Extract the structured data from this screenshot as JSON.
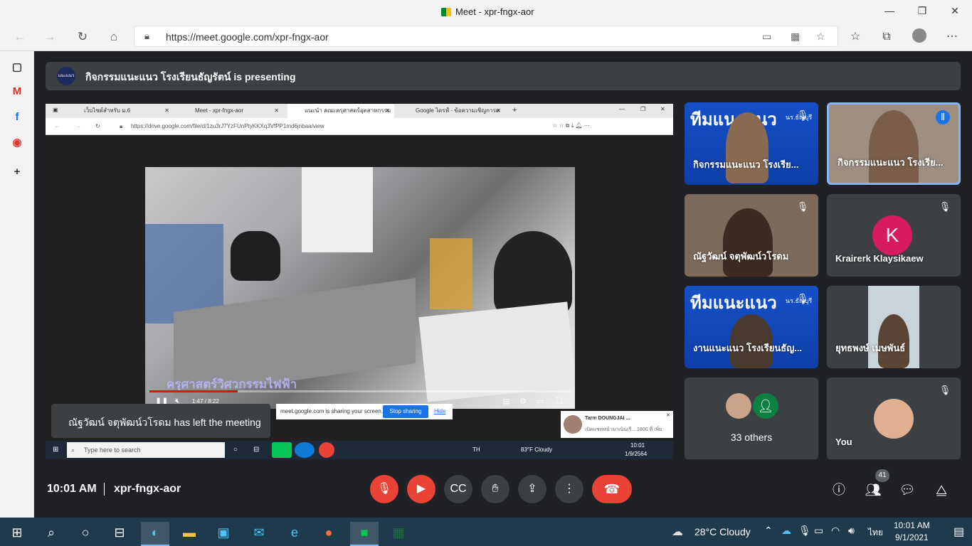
{
  "window": {
    "title": "Meet - xpr-fngx-aor"
  },
  "browser": {
    "url": "https://meet.google.com/xpr-fngx-aor"
  },
  "presenting": {
    "logo_text": "แนะแนว",
    "banner": "กิจกรรมแนะแนว โรงเรียนธัญรัตน์ is presenting"
  },
  "shared_screen": {
    "tabs": [
      {
        "label": "เว็บไซต์สำหรับ ม.6"
      },
      {
        "label": "Meet - xpr-fngx-aor"
      },
      {
        "label": "แนะนำ คณะครุศาสตร์อุตสาหกรรม มจ"
      },
      {
        "label": "Google ไดรฟ์ - ข้อความเชิญการต"
      }
    ],
    "url": "https://drive.google.com/file/d/1zu3rJ7YzFUnPtyKKXq3VfPP1md6jnbaa/view",
    "video_caption": "ครุศาสตร์วิศวกรรมไฟฟ้า",
    "video_time": "1:47 / 8:22",
    "video_progress": 0.21,
    "share_notice": "meet.google.com is sharing your screen.",
    "stop_sharing": "Stop sharing",
    "hide": "Hide",
    "taskbar_search": "Type here to search",
    "taskbar_lang": "TH",
    "taskbar_weather": "83°F  Cloudy",
    "taskbar_time": "10:01",
    "taskbar_date": "1/9/2564",
    "notification_title": "Tarm  DOUNGJAI ...",
    "notification_text": "เปิดแชทหน้ามาเนินเรี... 1800 ที่ เพิ่ม"
  },
  "toast": "ณัฐวัฒน์ จตุพัฒน์วโรดม has left the meeting",
  "tiles": [
    {
      "name": "กิจกรรมแนะแนว โรงเรีย...",
      "brand": "ทีมแนะแนว",
      "brand_box": "แนะแนว",
      "sub": "นร.ธัญบุรี"
    },
    {
      "name": "กิจกรรมแนะแนว โรงเรีย..."
    },
    {
      "name": "ณัฐวัฒน์ จตุพัฒน์วโรดม"
    },
    {
      "name": "Krairerk Klaysikaew",
      "initial": "K"
    },
    {
      "name": "งานแนะแนว โรงเรียนธัญ...",
      "brand": "ทีมแนะแนว",
      "brand_box": "แนะแนว",
      "sub": "นร.ธัญบุรี"
    },
    {
      "name": "ยุทธพงษ์ เมษพันธ์"
    },
    {
      "name": "33 others"
    },
    {
      "name": "You"
    }
  ],
  "bottom": {
    "time": "10:01 AM",
    "meeting_code": "xpr-fngx-aor",
    "participant_count": "41"
  },
  "taskbar": {
    "weather": "28°C  Cloudy",
    "lang": "ไทย",
    "time": "10:01 AM",
    "date": "9/1/2021"
  },
  "colors": {
    "meet_bg": "#202124",
    "tile_bg": "#3c4043",
    "red": "#ea4335",
    "blue": "#1a73e8",
    "avatar_k": "#d81b60"
  }
}
